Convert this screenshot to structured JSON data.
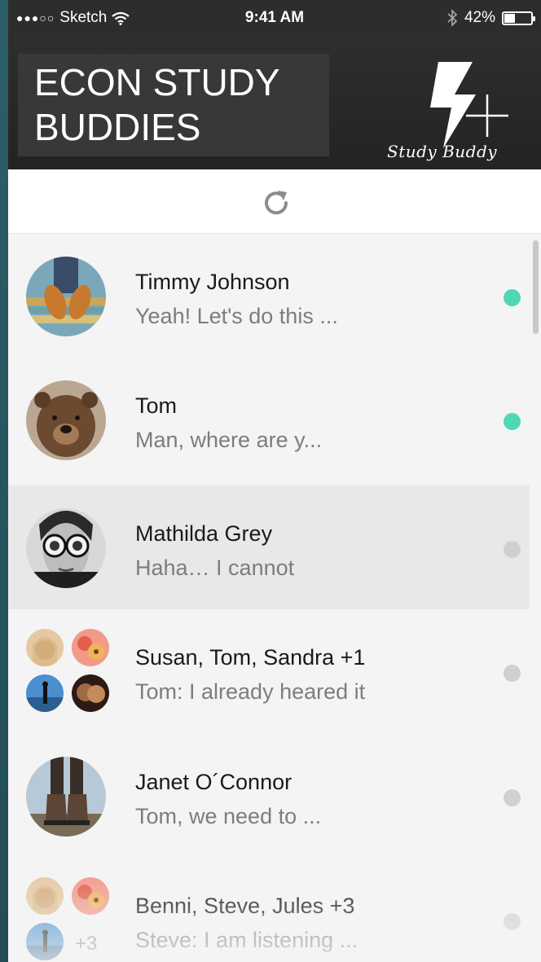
{
  "status_bar": {
    "carrier": "Sketch",
    "time": "9:41 AM",
    "battery": "42%",
    "battery_level": 0.42
  },
  "header": {
    "title": "ECON STUDY BUDDIES",
    "logo_caption": "Study Buddy"
  },
  "conversations": [
    {
      "name": "Timmy Johnson",
      "preview": "Yeah! Let's do this ...",
      "online": true
    },
    {
      "name": "Tom",
      "preview": "Man, where are y...",
      "online": true
    },
    {
      "name": "Mathilda Grey",
      "preview": "Haha… I cannot",
      "online": false,
      "selected": true
    },
    {
      "name": "Susan, Tom, Sandra +1",
      "preview": "Tom: I already heared it",
      "online": false
    },
    {
      "name": "Janet O´Connor",
      "preview": "Tom, we need to ...",
      "online": false
    },
    {
      "name": "Benni, Steve, Jules +3",
      "preview": "Steve: I am listening ...",
      "online": false,
      "extra_count": "+3"
    }
  ],
  "colors": {
    "online": "#4fd8b6",
    "offline": "#d0d0d0",
    "header": "#2d2d2d"
  }
}
